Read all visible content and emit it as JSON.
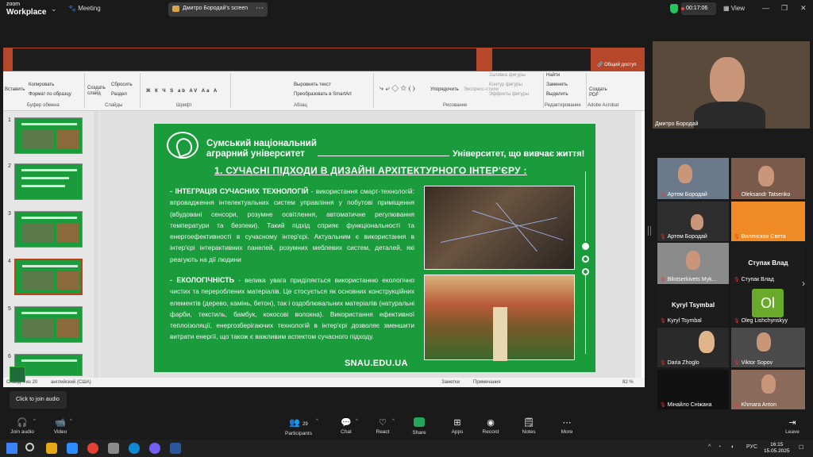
{
  "app": {
    "brand_small": "zoom",
    "brand": "Workplace",
    "meeting_label": "Meeting"
  },
  "share_pill": {
    "text": "Дмитро Бородай's screen"
  },
  "timer": "00:17:06",
  "view_label": "View",
  "ppt": {
    "share_access": "Общий доступ",
    "ribbon": {
      "paste": "Вставить",
      "copy": "Копировать",
      "format_painter": "Формат по образцу",
      "clipboard_group": "Буфер обмена",
      "new_slide": "Создать слайд",
      "reset": "Сбросить",
      "section": "Раздел",
      "slides_group": "Слайды",
      "font_group": "Шрифт",
      "align_text": "Выровнять текст",
      "smartart": "Преобразовать в SmartArt",
      "paragraph_group": "Абзац",
      "arrange": "Упорядочить",
      "express": "Экспресс-стили",
      "fill": "Заливка фигуры",
      "outline": "Контур фигуры",
      "effects": "Эффекты фигуры",
      "drawing_group": "Рисование",
      "find": "Найти",
      "replace": "Заменить",
      "select": "Выделить",
      "editing_group": "Редактирование",
      "create_pdf": "Создать PDF",
      "acrobat_group": "Adobe Acrobat"
    },
    "thumb_numbers": [
      "1",
      "2",
      "3",
      "4",
      "5",
      "6"
    ],
    "status": {
      "slide": "Слайд 4 из 20",
      "lang": "английский (США)",
      "notes": "Заметки",
      "comments": "Примечания",
      "zoom": "82 %"
    }
  },
  "slide": {
    "university": "Сумський національний аграрний університет",
    "motto": "Університет, що вивчає життя!",
    "heading": "1. СУЧАСНІ ПІДХОДИ В ДИЗАЙНІ АРХІТЕКТУРНОГО ІНТЕР'ЄРУ :",
    "p1_lead": "- ІНТЕГРАЦІЯ СУЧАСНИХ ТЕХНОЛОГІЙ",
    "p1_text": " - використання смарт-технологій: впровадження інтелектуальних систем управління у побутові приміщення (вбудовані сенсори, розумне освітлення, автоматичне регулювання температури та безпеки). Такий підхід сприяє функціональності та енергоефективності в сучасному інтер'єрі. Актуальним є використання в інтер'єрі інтерактивних панелей, розумних меблевих систем, деталей, які реагують на дії людини",
    "p2_lead": "- ЕКОЛОГІЧНІСТЬ",
    "p2_text": " - велика увага приділяється використанню екологічно чистих та перероблених матеріалів. Це стосується як основних конструкційних елементів (дерево, камінь, бетон), так і оздоблювальних матеріалів (натуральні фарби, текстиль, бамбук, кокосові волокна). Використання ефективної теплоізоляції, енергозберігаючих технологій в інтер'єрі дозволяє зменшити витрати енергії, що також є важливим аспектом сучасного підходу.",
    "url": "SNAU.EDU.UA"
  },
  "participants": [
    {
      "name": "Дмитро Бородай"
    },
    {
      "name": "Артем Бородай"
    },
    {
      "name": "Oleksandr Tatsenko"
    },
    {
      "name": "Артем Бородай"
    },
    {
      "name": "Виленская Света"
    },
    {
      "name": "Bilotserkivets Myk..."
    },
    {
      "name": "Ступак Влад",
      "center": "Ступак Влад"
    },
    {
      "name": "Kyryl Tsymbal",
      "center": "Kyryl Tsymbal"
    },
    {
      "name": "Oleg Lishchynskyy",
      "avatar": "Ol"
    },
    {
      "name": "Daria Zhoglo"
    },
    {
      "name": "Viktor Sopov"
    },
    {
      "name": "Мінайло Сніжана"
    },
    {
      "name": "Khmara Anton"
    }
  ],
  "tooltip": "Click to join audio",
  "toolbar": {
    "join_audio": "Join audio",
    "video": "Video",
    "participants": "Participants",
    "participants_count": "29",
    "chat": "Chat",
    "react": "React",
    "share": "Share",
    "apps": "Apps",
    "record": "Record",
    "notes": "Notes",
    "more": "More",
    "leave": "Leave"
  },
  "taskbar": {
    "lang": "РУС",
    "time": "16:15",
    "date": "15.05.2025"
  }
}
